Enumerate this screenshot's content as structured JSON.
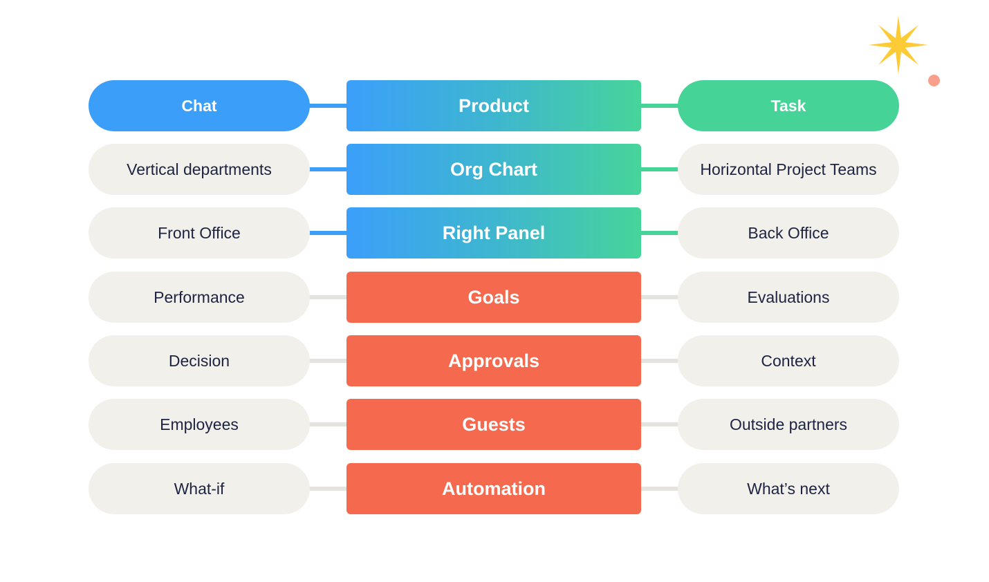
{
  "rows": [
    {
      "left": "Chat",
      "center": "Product",
      "right": "Task"
    },
    {
      "left": "Vertical departments",
      "center": "Org Chart",
      "right": "Horizontal Project Teams"
    },
    {
      "left": "Front Office",
      "center": "Right Panel",
      "right": "Back Office"
    },
    {
      "left": "Performance",
      "center": "Goals",
      "right": "Evaluations"
    },
    {
      "left": "Decision",
      "center": "Approvals",
      "right": "Context"
    },
    {
      "left": "Employees",
      "center": "Guests",
      "right": "Outside partners"
    },
    {
      "left": "What-if",
      "center": "Automation",
      "right": "What’s next"
    }
  ],
  "colors": {
    "blue": "#3b9ffa",
    "green": "#46d398",
    "red": "#f56a4e",
    "pill_bg": "#f1f0eb",
    "text_dark": "#1d2340",
    "star": "#fdcb35",
    "dot": "#f9a08c"
  },
  "decorations": [
    "sparkle-star-icon",
    "dot"
  ]
}
